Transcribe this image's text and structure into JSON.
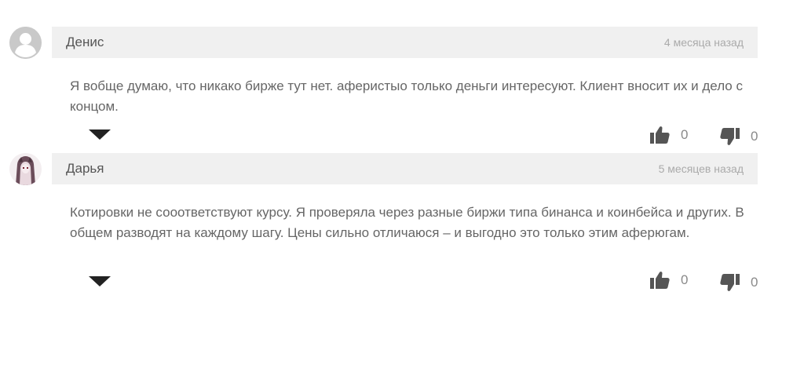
{
  "comments": [
    {
      "author": "Денис",
      "date": "4 месяца назад",
      "text": "Я вобще думаю, что никако бирже тут нет. аферистыо только деньги интересуют. Клиент вносит их и дело с концом.",
      "avatar": "default-user-icon",
      "likes": "0",
      "dislikes": "0"
    },
    {
      "author": "Дарья",
      "date": "5 месяцев назад",
      "text": "Котировки не сооответствуют курсу. Я проверяла через разные биржи типа бинанса и коинбейса и других. В общем разводят на каждому шагу. Цены сильно отличаюся – и выгодно это только этим аферюгам.",
      "avatar": "user-photo",
      "likes": "0",
      "dislikes": "0"
    }
  ],
  "icons": {
    "expand": "caret-down-icon",
    "like": "thumbs-up-icon",
    "dislike": "thumbs-down-icon"
  },
  "colors": {
    "header_bg": "#f0f0f0",
    "icon": "#555555",
    "text": "#666666",
    "meta": "#aaaaaa"
  }
}
